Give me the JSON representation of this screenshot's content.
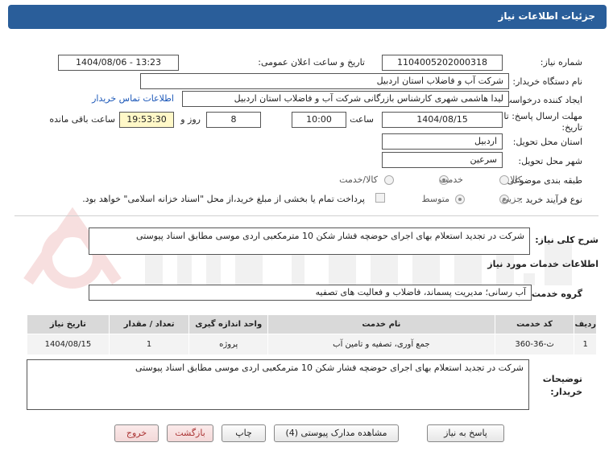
{
  "header": {
    "title": "جزئیات اطلاعات نیاز"
  },
  "form": {
    "need_number_label": "شماره نیاز:",
    "need_number": "1104005202000318",
    "announce_label": "تاریخ و ساعت اعلان عمومی:",
    "announce_value": "1404/08/06 - 13:23",
    "buyer_org_label": "نام دستگاه خریدار:",
    "buyer_org": "شرکت آب و فاضلاب استان اردبیل",
    "creator_label": "ایجاد کننده درخواست:",
    "creator": "لیدا  هاشمی شهری کارشناس بازرگانی شرکت آب و فاضلاب استان اردبیل",
    "contact_link": "اطلاعات تماس خریدار",
    "deadline_label_1": "مهلت ارسال پاسخ: تا",
    "deadline_label_2": "تاریخ:",
    "deadline_date": "1404/08/15",
    "time_label": "ساعت",
    "deadline_time": "10:00",
    "days_value": "8",
    "days_label": "روز و",
    "remaining_time": "19:53:30",
    "remaining_label": "ساعت باقی مانده",
    "province_label": "استان محل تحویل:",
    "province": "اردبیل",
    "city_label": "شهر محل تحویل:",
    "city": "سرعین",
    "category_label": "طبقه بندی موضوعی:",
    "category_options": [
      "کالا",
      "خدمت",
      "کالا/خدمت"
    ],
    "category_selected": 1,
    "process_label": "نوع فرآیند خرید :",
    "process_options": [
      "جزیی",
      "متوسط"
    ],
    "process_selected": 0,
    "payment_note": "پرداخت تمام یا بخشی از مبلغ خرید،از محل \"اسناد خزانه اسلامی\" خواهد بود."
  },
  "description": {
    "label": "شرح کلی نیاز:",
    "text": "شرکت  در تجدید استعلام بهای اجرای حوضچه فشار شکن 10 مترمکعبی اردی موسی مطابق اسناد پیوستی"
  },
  "services": {
    "section_title": "اطلاعات خدمات مورد نیاز",
    "group_label": "گروه خدمت:",
    "group_value": "آب رسانی؛ مدیریت پسماند، فاضلاب و فعالیت های تصفیه",
    "table": {
      "headers": [
        "ردیف",
        "کد خدمت",
        "نام خدمت",
        "واحد اندازه گیری",
        "تعداد / مقدار",
        "تاریخ نیاز"
      ],
      "rows": [
        [
          "1",
          "ث-36-360",
          "جمع آوری، تصفیه و تامین آب",
          "پروژه",
          "1",
          "1404/08/15"
        ]
      ]
    }
  },
  "buyer_notes": {
    "label_1": "توضیحات",
    "label_2": "خریدار:",
    "text": "شرکت  در تجدید استعلام بهای اجرای حوضچه فشار شکن 10 مترمکعبی اردی موسی مطابق اسناد پیوستی"
  },
  "buttons": {
    "reply": "پاسخ به نیاز",
    "attachments": "مشاهده مدارک پیوستی (4)",
    "print": "چاپ",
    "back": "بازگشت",
    "exit": "خروج"
  },
  "colors": {
    "header_bg": "#2a5e9a",
    "link": "#1b57b8",
    "highlight": "#fff8c8"
  }
}
